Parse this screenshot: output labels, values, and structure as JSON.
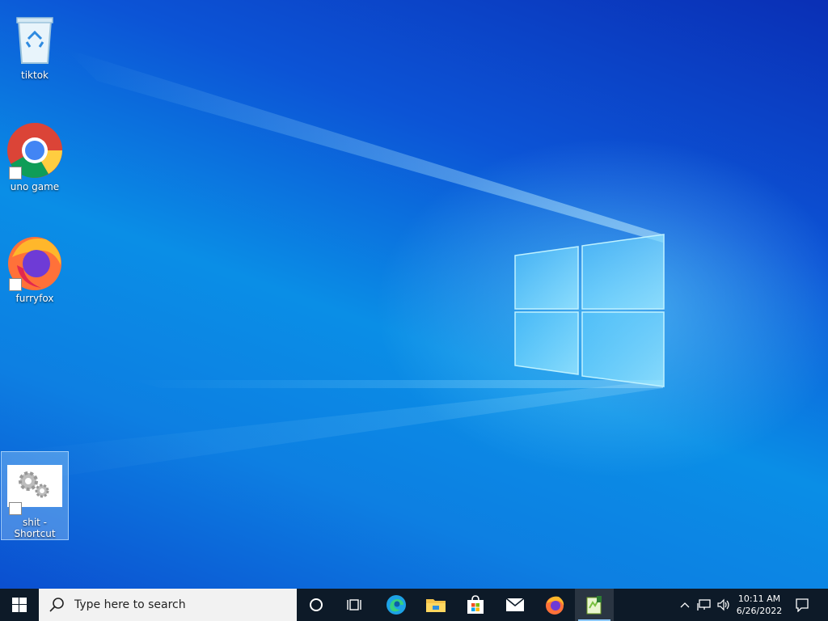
{
  "desktop": {
    "icons": [
      {
        "label": "tiktok",
        "icon": "recycle-bin-icon"
      },
      {
        "label": "uno game",
        "icon": "chrome-icon"
      },
      {
        "label": "furryfox",
        "icon": "firefox-icon"
      },
      {
        "label": "shit - Shortcut",
        "icon": "gears-icon"
      }
    ]
  },
  "taskbar": {
    "search_placeholder": "Type here to search",
    "apps": [
      "cortana-icon",
      "task-view-icon",
      "edge-icon",
      "file-explorer-icon",
      "store-icon",
      "mail-icon",
      "firefox-icon",
      "notepad-plus-plus-icon"
    ],
    "clock": {
      "time": "10:11 AM",
      "date": "6/26/2022"
    }
  },
  "colors": {
    "taskbar": "#0d1a28",
    "desktop_accent": "#0a8ee6"
  }
}
